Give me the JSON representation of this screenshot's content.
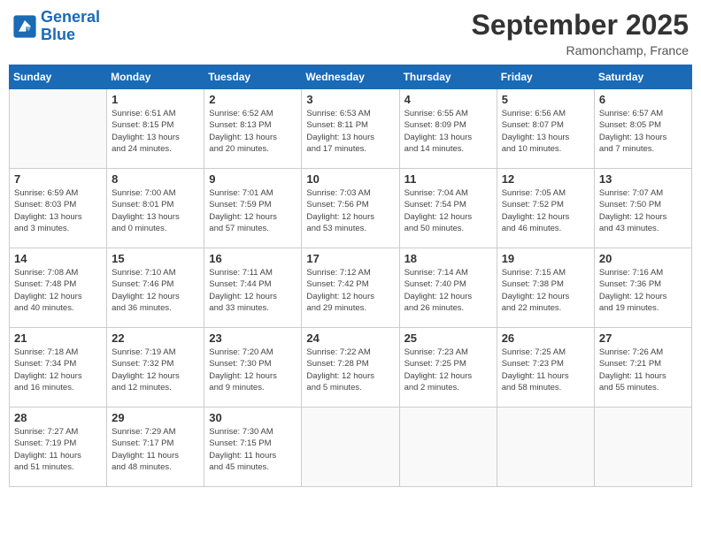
{
  "header": {
    "logo_line1": "General",
    "logo_line2": "Blue",
    "month_title": "September 2025",
    "location": "Ramonchamp, France"
  },
  "calendar": {
    "days_of_week": [
      "Sunday",
      "Monday",
      "Tuesday",
      "Wednesday",
      "Thursday",
      "Friday",
      "Saturday"
    ],
    "weeks": [
      [
        {
          "day": "",
          "info": ""
        },
        {
          "day": "1",
          "info": "Sunrise: 6:51 AM\nSunset: 8:15 PM\nDaylight: 13 hours\nand 24 minutes."
        },
        {
          "day": "2",
          "info": "Sunrise: 6:52 AM\nSunset: 8:13 PM\nDaylight: 13 hours\nand 20 minutes."
        },
        {
          "day": "3",
          "info": "Sunrise: 6:53 AM\nSunset: 8:11 PM\nDaylight: 13 hours\nand 17 minutes."
        },
        {
          "day": "4",
          "info": "Sunrise: 6:55 AM\nSunset: 8:09 PM\nDaylight: 13 hours\nand 14 minutes."
        },
        {
          "day": "5",
          "info": "Sunrise: 6:56 AM\nSunset: 8:07 PM\nDaylight: 13 hours\nand 10 minutes."
        },
        {
          "day": "6",
          "info": "Sunrise: 6:57 AM\nSunset: 8:05 PM\nDaylight: 13 hours\nand 7 minutes."
        }
      ],
      [
        {
          "day": "7",
          "info": "Sunrise: 6:59 AM\nSunset: 8:03 PM\nDaylight: 13 hours\nand 3 minutes."
        },
        {
          "day": "8",
          "info": "Sunrise: 7:00 AM\nSunset: 8:01 PM\nDaylight: 13 hours\nand 0 minutes."
        },
        {
          "day": "9",
          "info": "Sunrise: 7:01 AM\nSunset: 7:59 PM\nDaylight: 12 hours\nand 57 minutes."
        },
        {
          "day": "10",
          "info": "Sunrise: 7:03 AM\nSunset: 7:56 PM\nDaylight: 12 hours\nand 53 minutes."
        },
        {
          "day": "11",
          "info": "Sunrise: 7:04 AM\nSunset: 7:54 PM\nDaylight: 12 hours\nand 50 minutes."
        },
        {
          "day": "12",
          "info": "Sunrise: 7:05 AM\nSunset: 7:52 PM\nDaylight: 12 hours\nand 46 minutes."
        },
        {
          "day": "13",
          "info": "Sunrise: 7:07 AM\nSunset: 7:50 PM\nDaylight: 12 hours\nand 43 minutes."
        }
      ],
      [
        {
          "day": "14",
          "info": "Sunrise: 7:08 AM\nSunset: 7:48 PM\nDaylight: 12 hours\nand 40 minutes."
        },
        {
          "day": "15",
          "info": "Sunrise: 7:10 AM\nSunset: 7:46 PM\nDaylight: 12 hours\nand 36 minutes."
        },
        {
          "day": "16",
          "info": "Sunrise: 7:11 AM\nSunset: 7:44 PM\nDaylight: 12 hours\nand 33 minutes."
        },
        {
          "day": "17",
          "info": "Sunrise: 7:12 AM\nSunset: 7:42 PM\nDaylight: 12 hours\nand 29 minutes."
        },
        {
          "day": "18",
          "info": "Sunrise: 7:14 AM\nSunset: 7:40 PM\nDaylight: 12 hours\nand 26 minutes."
        },
        {
          "day": "19",
          "info": "Sunrise: 7:15 AM\nSunset: 7:38 PM\nDaylight: 12 hours\nand 22 minutes."
        },
        {
          "day": "20",
          "info": "Sunrise: 7:16 AM\nSunset: 7:36 PM\nDaylight: 12 hours\nand 19 minutes."
        }
      ],
      [
        {
          "day": "21",
          "info": "Sunrise: 7:18 AM\nSunset: 7:34 PM\nDaylight: 12 hours\nand 16 minutes."
        },
        {
          "day": "22",
          "info": "Sunrise: 7:19 AM\nSunset: 7:32 PM\nDaylight: 12 hours\nand 12 minutes."
        },
        {
          "day": "23",
          "info": "Sunrise: 7:20 AM\nSunset: 7:30 PM\nDaylight: 12 hours\nand 9 minutes."
        },
        {
          "day": "24",
          "info": "Sunrise: 7:22 AM\nSunset: 7:28 PM\nDaylight: 12 hours\nand 5 minutes."
        },
        {
          "day": "25",
          "info": "Sunrise: 7:23 AM\nSunset: 7:25 PM\nDaylight: 12 hours\nand 2 minutes."
        },
        {
          "day": "26",
          "info": "Sunrise: 7:25 AM\nSunset: 7:23 PM\nDaylight: 11 hours\nand 58 minutes."
        },
        {
          "day": "27",
          "info": "Sunrise: 7:26 AM\nSunset: 7:21 PM\nDaylight: 11 hours\nand 55 minutes."
        }
      ],
      [
        {
          "day": "28",
          "info": "Sunrise: 7:27 AM\nSunset: 7:19 PM\nDaylight: 11 hours\nand 51 minutes."
        },
        {
          "day": "29",
          "info": "Sunrise: 7:29 AM\nSunset: 7:17 PM\nDaylight: 11 hours\nand 48 minutes."
        },
        {
          "day": "30",
          "info": "Sunrise: 7:30 AM\nSunset: 7:15 PM\nDaylight: 11 hours\nand 45 minutes."
        },
        {
          "day": "",
          "info": ""
        },
        {
          "day": "",
          "info": ""
        },
        {
          "day": "",
          "info": ""
        },
        {
          "day": "",
          "info": ""
        }
      ]
    ]
  }
}
